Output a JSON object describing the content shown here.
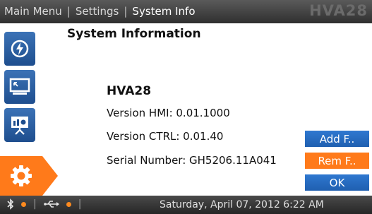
{
  "header": {
    "breadcrumb": [
      "Main Menu",
      "Settings",
      "System Info"
    ],
    "device_model": "HVA28"
  },
  "sidebar": {
    "items": [
      {
        "icon": "power-bolt-icon"
      },
      {
        "icon": "monitor-icon"
      },
      {
        "icon": "presentation-icon"
      },
      {
        "icon": "gear-icon",
        "active": true
      }
    ]
  },
  "main": {
    "title": "System Information",
    "model": "HVA28",
    "version_hmi": "Version HMI: 0.01.1000",
    "version_ctrl": "Version CTRL: 0.01.40",
    "serial_number": "Serial Number: GH5206.11A041"
  },
  "buttons": {
    "add": "Add F..",
    "remove": "Rem F..",
    "ok": "OK"
  },
  "status": {
    "datetime": "Saturday, April 07, 2012 6:22 AM"
  },
  "colors": {
    "accent_orange": "#ff7a1a",
    "button_blue": "#1f5fb0"
  }
}
